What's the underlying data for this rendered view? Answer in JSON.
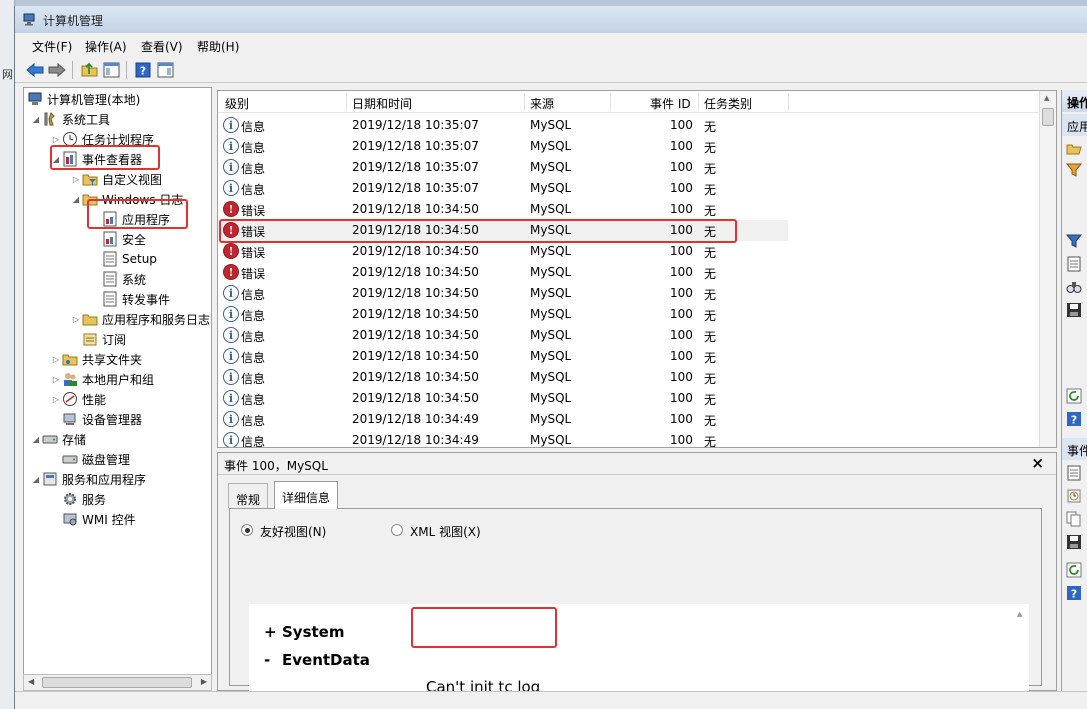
{
  "window": {
    "title": "计算机管理"
  },
  "menu": {
    "file": "文件(F)",
    "action": "操作(A)",
    "view": "查看(V)",
    "help": "帮助(H)"
  },
  "background": {
    "side_label": "网"
  },
  "tree": {
    "root": "计算机管理(本地)",
    "system_tools": "系统工具",
    "task_scheduler": "任务计划程序",
    "event_viewer": "事件查看器",
    "custom_views": "自定义视图",
    "windows_logs": "Windows 日志",
    "application": "应用程序",
    "security": "安全",
    "setup": "Setup",
    "system": "系统",
    "forwarded": "转发事件",
    "app_service_logs": "应用程序和服务日志",
    "subscriptions": "订阅",
    "shared_folders": "共享文件夹",
    "local_users": "本地用户和组",
    "performance": "性能",
    "device_manager": "设备管理器",
    "storage": "存储",
    "disk_management": "磁盘管理",
    "services_apps": "服务和应用程序",
    "services": "服务",
    "wmi": "WMI 控件"
  },
  "list": {
    "columns": [
      "级别",
      "日期和时间",
      "来源",
      "事件 ID",
      "任务类别"
    ],
    "rows": [
      {
        "level": "信息",
        "type": "info",
        "datetime": "2019/12/18 10:35:07",
        "source": "MySQL",
        "id": "100",
        "category": "无"
      },
      {
        "level": "信息",
        "type": "info",
        "datetime": "2019/12/18 10:35:07",
        "source": "MySQL",
        "id": "100",
        "category": "无"
      },
      {
        "level": "信息",
        "type": "info",
        "datetime": "2019/12/18 10:35:07",
        "source": "MySQL",
        "id": "100",
        "category": "无"
      },
      {
        "level": "信息",
        "type": "info",
        "datetime": "2019/12/18 10:35:07",
        "source": "MySQL",
        "id": "100",
        "category": "无"
      },
      {
        "level": "错误",
        "type": "err",
        "datetime": "2019/12/18 10:34:50",
        "source": "MySQL",
        "id": "100",
        "category": "无"
      },
      {
        "level": "错误",
        "type": "err",
        "datetime": "2019/12/18 10:34:50",
        "source": "MySQL",
        "id": "100",
        "category": "无"
      },
      {
        "level": "错误",
        "type": "err",
        "datetime": "2019/12/18 10:34:50",
        "source": "MySQL",
        "id": "100",
        "category": "无"
      },
      {
        "level": "错误",
        "type": "err",
        "datetime": "2019/12/18 10:34:50",
        "source": "MySQL",
        "id": "100",
        "category": "无"
      },
      {
        "level": "信息",
        "type": "info",
        "datetime": "2019/12/18 10:34:50",
        "source": "MySQL",
        "id": "100",
        "category": "无"
      },
      {
        "level": "信息",
        "type": "info",
        "datetime": "2019/12/18 10:34:50",
        "source": "MySQL",
        "id": "100",
        "category": "无"
      },
      {
        "level": "信息",
        "type": "info",
        "datetime": "2019/12/18 10:34:50",
        "source": "MySQL",
        "id": "100",
        "category": "无"
      },
      {
        "level": "信息",
        "type": "info",
        "datetime": "2019/12/18 10:34:50",
        "source": "MySQL",
        "id": "100",
        "category": "无"
      },
      {
        "level": "信息",
        "type": "info",
        "datetime": "2019/12/18 10:34:50",
        "source": "MySQL",
        "id": "100",
        "category": "无"
      },
      {
        "level": "信息",
        "type": "info",
        "datetime": "2019/12/18 10:34:50",
        "source": "MySQL",
        "id": "100",
        "category": "无"
      },
      {
        "level": "信息",
        "type": "info",
        "datetime": "2019/12/18 10:34:49",
        "source": "MySQL",
        "id": "100",
        "category": "无"
      },
      {
        "level": "信息",
        "type": "info",
        "datetime": "2019/12/18 10:34:49",
        "source": "MySQL",
        "id": "100",
        "category": "无"
      }
    ],
    "selected_index": 5
  },
  "detail": {
    "title": "事件 100，MySQL",
    "close": "×",
    "tab_general": "常规",
    "tab_details": "详细信息",
    "radio_friendly": "友好视图(N)",
    "radio_xml": "XML 视图(X)",
    "system_sign": "+",
    "system": "System",
    "eventdata_sign": "-",
    "eventdata": "EventData",
    "message": "Can't init tc log"
  },
  "actions": {
    "header1": "操作",
    "header2": "应用",
    "header3": "事件"
  },
  "colors": {
    "highlight": "#e53030",
    "info": "#3b5f94",
    "error": "#c0262f"
  }
}
